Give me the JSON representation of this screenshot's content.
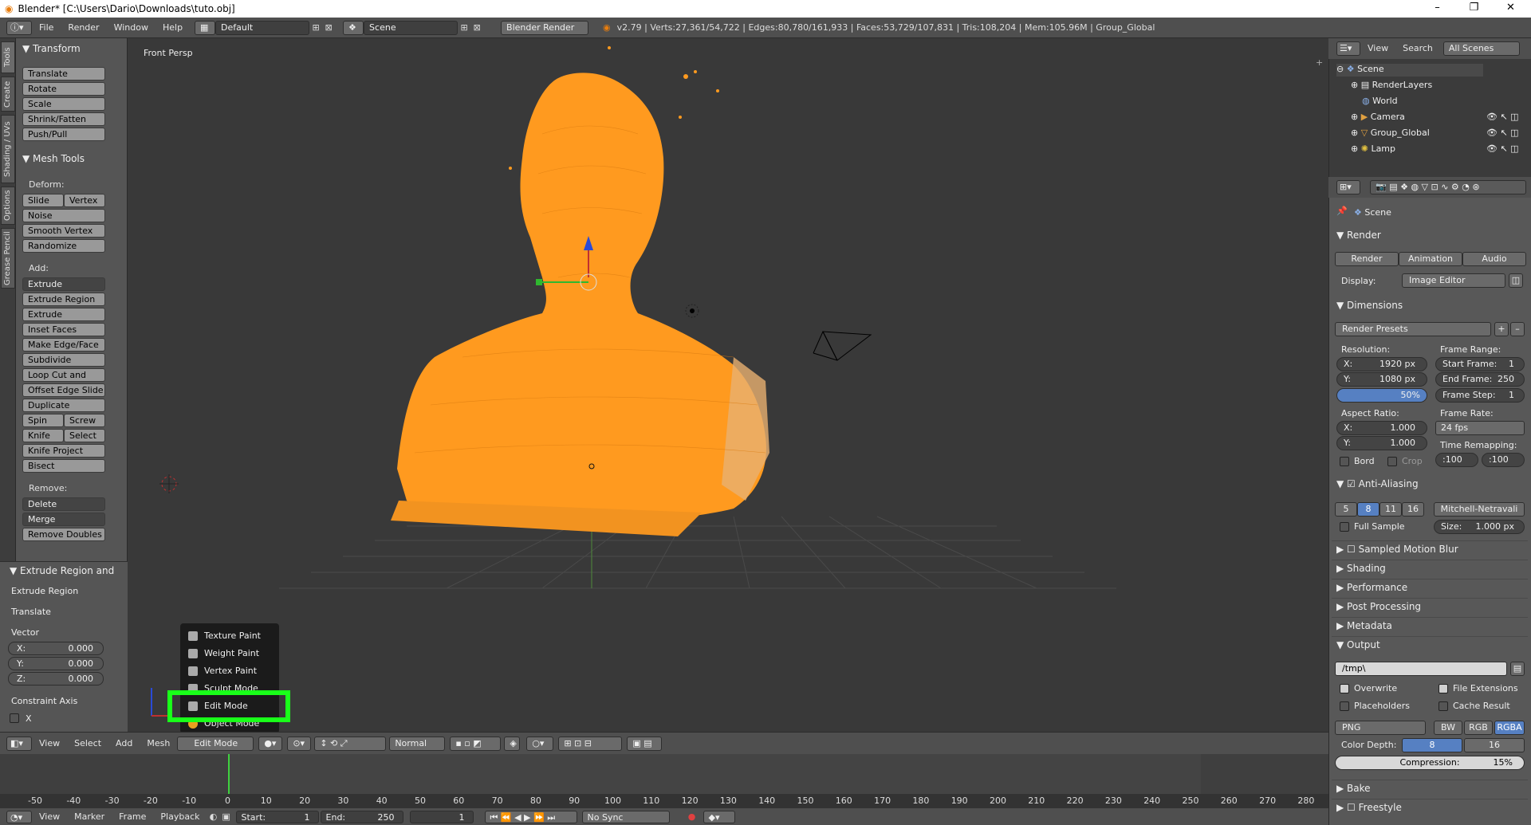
{
  "window": {
    "title": "Blender* [C:\\Users\\Dario\\Downloads\\tuto.obj]",
    "minimize": "–",
    "maximize": "❐",
    "close": "✕"
  },
  "info_header": {
    "menus": [
      "File",
      "Render",
      "Window",
      "Help"
    ],
    "screen_layout": "Default",
    "scene": "Scene",
    "engine": "Blender Render",
    "stats": "v2.79 | Verts:27,361/54,722 | Edges:80,780/161,933 | Faces:53,729/107,831 | Tris:108,204 | Mem:105.96M | Group_Global"
  },
  "tool_tabs": [
    "Tools",
    "Create",
    "Shading / UVs",
    "Options",
    "Grease Pencil"
  ],
  "tool_shelf": {
    "transform_header": "Transform",
    "transform_buttons": [
      "Translate",
      "Rotate",
      "Scale",
      "Shrink/Fatten",
      "Push/Pull"
    ],
    "mesh_tools_header": "Mesh Tools",
    "deform_label": "Deform:",
    "slide_edge": "Slide Ed",
    "vertex": "Vertex",
    "noise": "Noise",
    "smooth_vertex": "Smooth Vertex",
    "randomize": "Randomize",
    "add_label": "Add:",
    "extrude": "Extrude",
    "extrude_region": "Extrude Region",
    "extrude_individual": "Extrude Individual",
    "inset_faces": "Inset Faces",
    "make_edge_face": "Make Edge/Face",
    "subdivide": "Subdivide",
    "loop_cut": "Loop Cut and Slide",
    "offset_edge": "Offset Edge Slide",
    "duplicate": "Duplicate",
    "spin": "Spin",
    "screw": "Screw",
    "knife": "Knife",
    "select": "Select",
    "knife_project": "Knife Project",
    "bisect": "Bisect",
    "remove_label": "Remove:",
    "delete": "Delete",
    "merge": "Merge",
    "remove_doubles": "Remove Doubles"
  },
  "operator_panel": {
    "header": "Extrude Region and",
    "line1": "Extrude Region",
    "line2": "Translate",
    "vector_label": "Vector",
    "x": "X:",
    "x_val": "0.000",
    "y": "Y:",
    "y_val": "0.000",
    "z": "Z:",
    "z_val": "0.000",
    "constraint_label": "Constraint Axis",
    "cx": "X"
  },
  "viewport": {
    "label": "Front Persp"
  },
  "mode_menu": {
    "items": [
      "Texture Paint",
      "Weight Paint",
      "Vertex Paint",
      "Sculpt Mode",
      "Edit Mode",
      "Object Mode"
    ],
    "highlighted": "Edit Mode"
  },
  "view3d_header": {
    "menus": [
      "View",
      "Select",
      "Add",
      "Mesh"
    ],
    "mode": "Edit Mode",
    "pivot": "Normal"
  },
  "timeline": {
    "ticks": [
      "-50",
      "-40",
      "-30",
      "-20",
      "-10",
      "0",
      "10",
      "20",
      "30",
      "40",
      "50",
      "60",
      "70",
      "80",
      "90",
      "100",
      "110",
      "120",
      "130",
      "140",
      "150",
      "160",
      "170",
      "180",
      "190",
      "200",
      "210",
      "220",
      "230",
      "240",
      "250",
      "260",
      "270",
      "280"
    ],
    "menus": [
      "View",
      "Marker",
      "Frame",
      "Playback"
    ],
    "start_label": "Start:",
    "start_val": "1",
    "end_label": "End:",
    "end_val": "250",
    "current": "1",
    "sync": "No Sync"
  },
  "outliner": {
    "menus": [
      "View",
      "Search"
    ],
    "filter": "All Scenes",
    "items": [
      "Scene",
      "RenderLayers",
      "World",
      "Camera",
      "Group_Global",
      "Lamp"
    ]
  },
  "properties": {
    "scene": "Scene",
    "render_header": "Render",
    "render_btn": "Render",
    "animation_btn": "Animation",
    "audio_btn": "Audio",
    "display_label": "Display:",
    "display_val": "Image Editor",
    "dimensions_header": "Dimensions",
    "presets": "Render Presets",
    "resolution_label": "Resolution:",
    "frame_range_label": "Frame Range:",
    "res_x_label": "X:",
    "res_x": "1920 px",
    "res_y_label": "Y:",
    "res_y": "1080 px",
    "res_pct": "50%",
    "start_frame_label": "Start Frame:",
    "start_frame": "1",
    "end_frame_label": "End Frame:",
    "end_frame": "250",
    "frame_step_label": "Frame Step:",
    "frame_step": "1",
    "aspect_label": "Aspect Ratio:",
    "frame_rate_label": "Frame Rate:",
    "asp_x_label": "X:",
    "asp_x": "1.000",
    "asp_y_label": "Y:",
    "asp_y": "1.000",
    "fps": "24 fps",
    "time_remap_label": "Time Remapping:",
    "remap_old": ":100",
    "remap_new": ":100",
    "bord": "Bord",
    "crop": "Crop",
    "aa_header": "Anti-Aliasing",
    "aa_samples": [
      "5",
      "8",
      "11",
      "16"
    ],
    "aa_filter": "Mitchell-Netravali",
    "full_sample": "Full Sample",
    "size_label": "Size:",
    "size_val": "1.000 px",
    "motion_blur": "Sampled Motion Blur",
    "shading": "Shading",
    "performance": "Performance",
    "post_processing": "Post Processing",
    "metadata": "Metadata",
    "output_header": "Output",
    "output_path": "/tmp\\",
    "overwrite": "Overwrite",
    "file_ext": "File Extensions",
    "placeholders": "Placeholders",
    "cache_result": "Cache Result",
    "format": "PNG",
    "bw": "BW",
    "rgb": "RGB",
    "rgba": "RGBA",
    "color_depth_label": "Color Depth:",
    "depth_8": "8",
    "depth_16": "16",
    "compression_label": "Compression:",
    "compression_val": "15%",
    "bake": "Bake",
    "freestyle": "Freestyle"
  },
  "colors": {
    "mesh_orange": "#ff9a1f",
    "highlight_green": "#19ff19",
    "selected_blue": "#5680c2"
  }
}
